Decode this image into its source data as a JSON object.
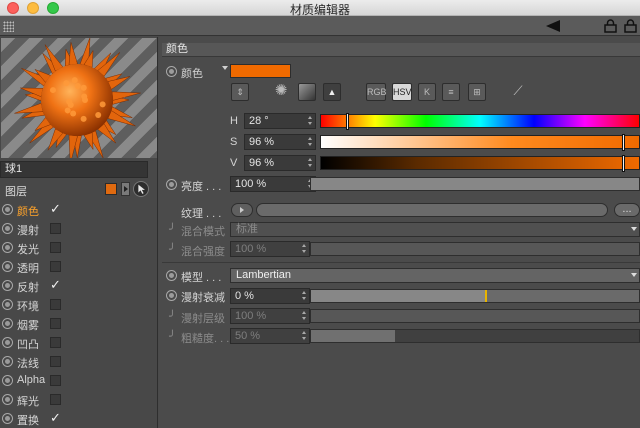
{
  "window": {
    "title": "材质编辑器"
  },
  "colors": {
    "material": "#f06a00",
    "accent_text": "#ffa32a"
  },
  "icons": {
    "toolbar": [
      "grip-icon",
      "back-arrow-icon",
      "lock-icon",
      "lock-icon"
    ]
  },
  "left_panel": {
    "material_name": "球1",
    "layer_label": "图层",
    "channels": [
      {
        "label": "颜色",
        "checked": true,
        "active": true
      },
      {
        "label": "漫射",
        "checked": false
      },
      {
        "label": "发光",
        "checked": false
      },
      {
        "label": "透明",
        "checked": false
      },
      {
        "label": "反射",
        "checked": true
      },
      {
        "label": "环境",
        "checked": false
      },
      {
        "label": "烟雾",
        "checked": false
      },
      {
        "label": "凹凸",
        "checked": false
      },
      {
        "label": "法线",
        "checked": false
      },
      {
        "label": "Alpha",
        "checked": false
      },
      {
        "label": "辉光",
        "checked": false
      },
      {
        "label": "置换",
        "checked": true
      }
    ]
  },
  "color_section": {
    "header": "颜色",
    "color_label": "颜色",
    "tools": [
      "RGB",
      "HSV",
      "K"
    ],
    "h": {
      "label": "H",
      "value": "28 °",
      "fraction": 0.078
    },
    "s": {
      "label": "S",
      "value": "96 %",
      "fraction": 0.96
    },
    "v": {
      "label": "V",
      "value": "96 %",
      "fraction": 0.96
    },
    "brightness": {
      "label": "亮度 . . .",
      "value": "100 %"
    },
    "texture": {
      "label": "纹理 . . .",
      "more": "..."
    },
    "mix_mode": {
      "label": "混合模式",
      "value": "标准"
    },
    "mix_strength": {
      "label": "混合强度",
      "value": "100 %"
    }
  },
  "model_section": {
    "model": {
      "label": "模型 . . .",
      "value": "Lambertian"
    },
    "diffuse_falloff": {
      "label": "漫射衰减",
      "value": "0 %",
      "marker_fraction": 0.53
    },
    "diffuse_level": {
      "label": "漫射层级",
      "value": "100 %"
    },
    "roughness": {
      "label": "粗糙度. . .",
      "value": "50 %",
      "fraction": 0.5
    }
  }
}
